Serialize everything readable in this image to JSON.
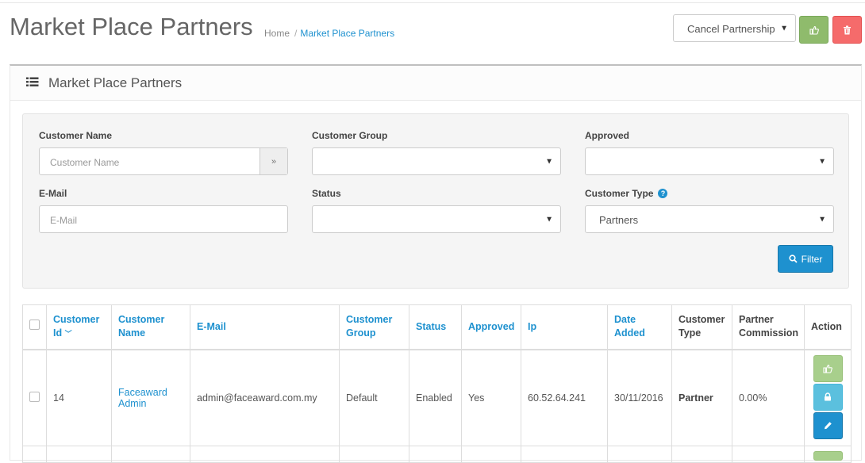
{
  "header": {
    "title": "Market Place Partners",
    "breadcrumb": [
      {
        "label": "Home"
      },
      {
        "label": "Market Place Partners"
      }
    ],
    "action_select_value": "Cancel Partnership",
    "approve_icon": "thumbs-up-icon",
    "delete_icon": "trash-icon",
    "colors": {
      "approve": "#8fbb6c",
      "delete": "#f56b6b",
      "primary": "#1e91cf"
    }
  },
  "panel": {
    "title": "Market Place Partners",
    "icon": "list-icon"
  },
  "filters": {
    "customer_name": {
      "label": "Customer Name",
      "placeholder": "Customer Name"
    },
    "customer_group": {
      "label": "Customer Group",
      "value": ""
    },
    "approved": {
      "label": "Approved",
      "value": ""
    },
    "email": {
      "label": "E-Mail",
      "placeholder": "E-Mail"
    },
    "status": {
      "label": "Status",
      "value": ""
    },
    "customer_type": {
      "label": "Customer Type",
      "value": "Partners"
    },
    "filter_button": "Filter"
  },
  "table": {
    "columns": [
      {
        "label": "Customer Id",
        "sort": "desc"
      },
      {
        "label": "Customer Name"
      },
      {
        "label": "E-Mail"
      },
      {
        "label": "Customer Group"
      },
      {
        "label": "Status"
      },
      {
        "label": "Approved"
      },
      {
        "label": "Ip"
      },
      {
        "label": "Date Added"
      },
      {
        "label": "Customer Type"
      },
      {
        "label": "Partner Commission"
      },
      {
        "label": "Action"
      }
    ],
    "rows": [
      {
        "id": "14",
        "name": "Faceaward Admin",
        "email": "admin@faceaward.com.my",
        "group": "Default",
        "status": "Enabled",
        "approved": "Yes",
        "ip": "60.52.64.241",
        "date_added": "30/11/2016",
        "customer_type": "Partner",
        "commission": "0.00%"
      }
    ]
  }
}
